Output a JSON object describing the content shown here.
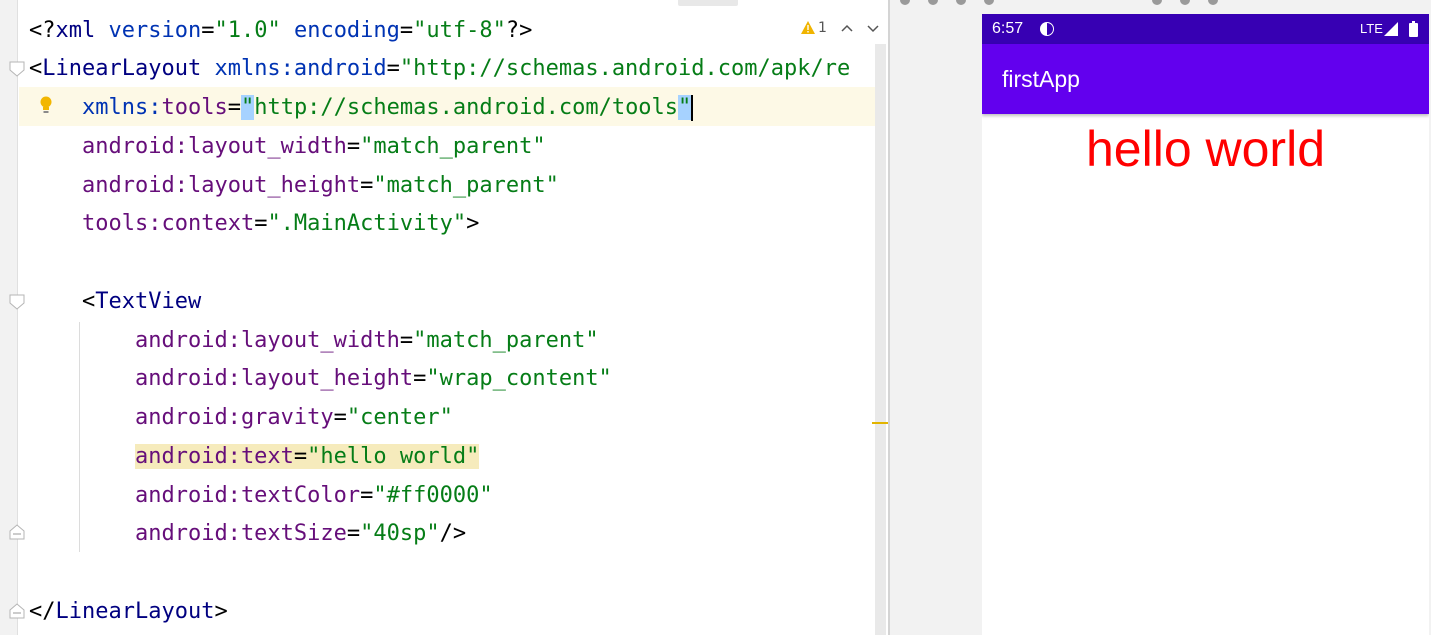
{
  "editor": {
    "warning_count": "1",
    "lines": {
      "l1": {
        "open": "<?",
        "tag": "xml",
        "attr1": "version",
        "eq1": "=",
        "val1": "\"1.0\"",
        "attr2": "encoding",
        "eq2": "=",
        "val2": "\"utf-8\"",
        "close": "?>"
      },
      "l2": {
        "open": "<",
        "tag": "LinearLayout",
        "attr": "xmlns:android",
        "eq": "=",
        "val": "\"http://schemas.android.com/apk/re"
      },
      "l3": {
        "ns": "xmlns:",
        "attr": "tools",
        "eq": "=",
        "q1": "\"",
        "val": "http://schemas.android.com/tools",
        "q2": "\""
      },
      "l4": {
        "ns": "android:",
        "attr": "layout_width",
        "eq": "=",
        "val": "\"match_parent\""
      },
      "l5": {
        "ns": "android:",
        "attr": "layout_height",
        "eq": "=",
        "val": "\"match_parent\""
      },
      "l6": {
        "ns": "tools:",
        "attr": "context",
        "eq": "=",
        "val": "\".MainActivity\"",
        "close": ">"
      },
      "l8": {
        "open": "<",
        "tag": "TextView"
      },
      "l9": {
        "ns": "android:",
        "attr": "layout_width",
        "eq": "=",
        "val": "\"match_parent\""
      },
      "l10": {
        "ns": "android:",
        "attr": "layout_height",
        "eq": "=",
        "val": "\"wrap_content\""
      },
      "l11": {
        "ns": "android:",
        "attr": "gravity",
        "eq": "=",
        "val": "\"center\""
      },
      "l12": {
        "ns": "android:",
        "attr": "text",
        "eq": "=",
        "val": "\"hello world\""
      },
      "l13": {
        "ns": "android:",
        "attr": "textColor",
        "eq": "=",
        "val": "\"#ff0000\""
      },
      "l14": {
        "ns": "android:",
        "attr": "textSize",
        "eq": "=",
        "val": "\"40sp\"",
        "close": "/>"
      },
      "l16": {
        "open": "</",
        "tag": "LinearLayout",
        "close": ">"
      }
    }
  },
  "preview": {
    "status_time": "6:57",
    "network": "LTE",
    "app_title": "firstApp",
    "text": "hello world",
    "text_color": "#ff0000",
    "status_bar_color": "#3700b3",
    "app_bar_color": "#6200ee"
  }
}
